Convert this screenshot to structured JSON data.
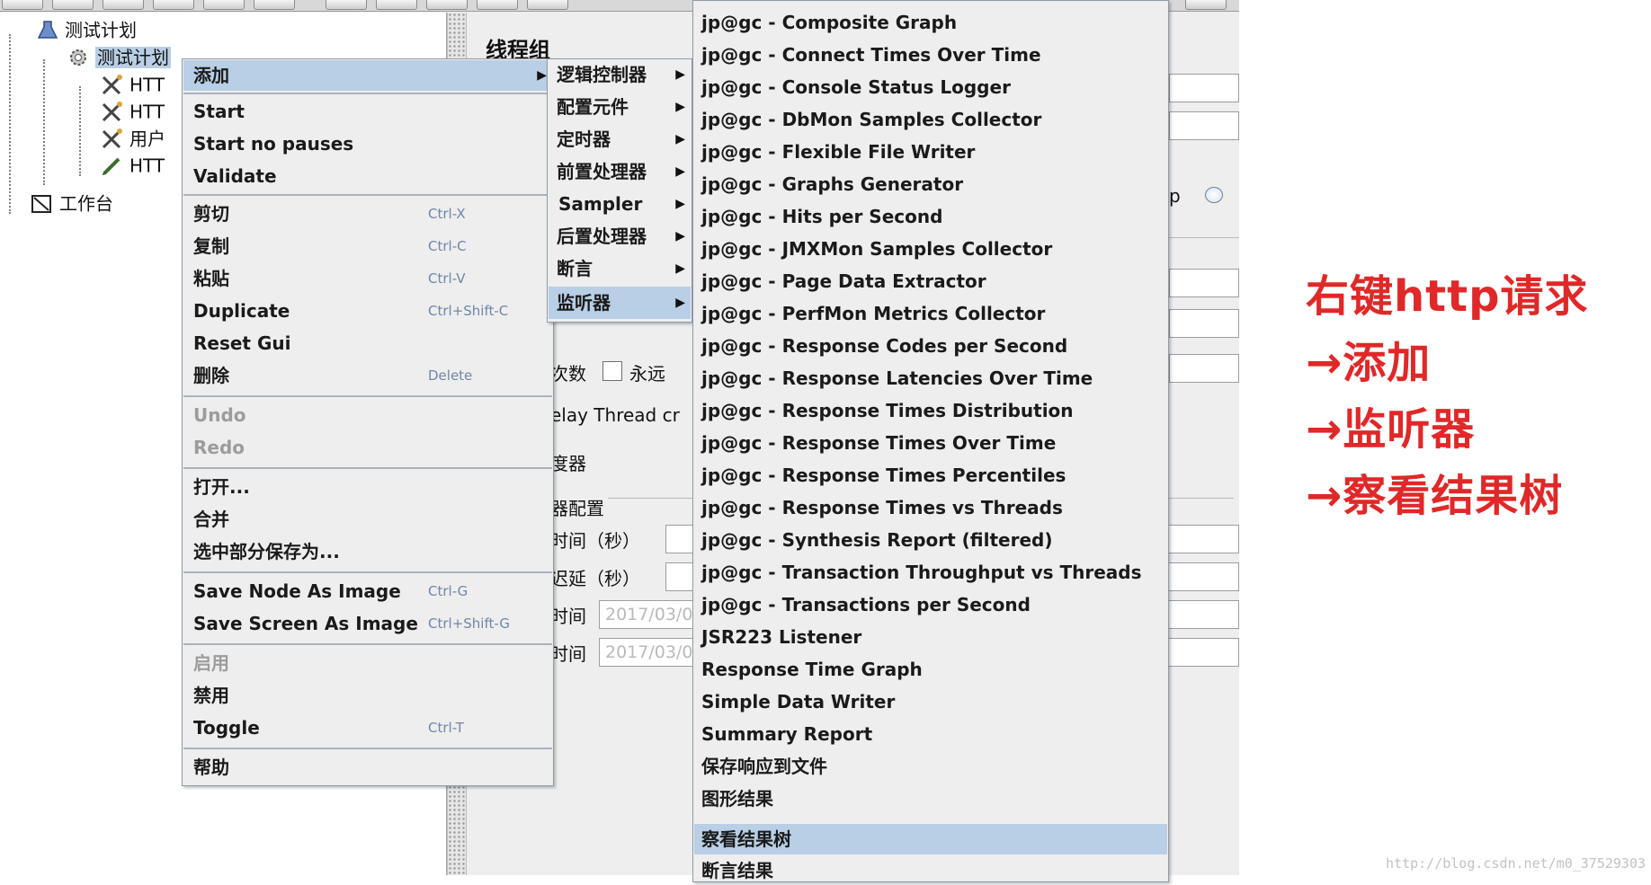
{
  "tree": {
    "items": [
      {
        "label": "测试计划",
        "icon": "test-plan-icon"
      },
      {
        "label": "测试计划",
        "icon": "thread-group-gear-icon"
      },
      {
        "label": "HTT",
        "icon": "http-sampler-icon"
      },
      {
        "label": "HTT",
        "icon": "http-sampler-icon"
      },
      {
        "label": "用户",
        "icon": "user-defined-icon"
      },
      {
        "label": "HTT",
        "icon": "http-sampler-icon"
      },
      {
        "label": "工作台",
        "icon": "workbench-icon"
      }
    ]
  },
  "editor": {
    "title": "线程组",
    "loop_count_label": "次数",
    "forever_label": "永远",
    "delay_label": "elay Thread cr",
    "scheduler_label": "度器",
    "scheduler_config_label": "器配置",
    "duration_label": "时间（秒）",
    "startup_delay_label": "迟延（秒）",
    "start_time_label": "时间",
    "end_time_label": "时间",
    "start_time_value": "2017/03/0",
    "end_time_value": "2017/03/0",
    "radio_label": "p"
  },
  "context_menu": {
    "items": [
      {
        "label": "添加",
        "submenu": true
      },
      {
        "label": "Start"
      },
      {
        "label": "Start no pauses"
      },
      {
        "label": "Validate"
      },
      {
        "label": "剪切",
        "accel": "Ctrl-X"
      },
      {
        "label": "复制",
        "accel": "Ctrl-C"
      },
      {
        "label": "粘贴",
        "accel": "Ctrl-V"
      },
      {
        "label": "Duplicate",
        "accel": "Ctrl+Shift-C"
      },
      {
        "label": "Reset Gui"
      },
      {
        "label": "删除",
        "accel": "Delete"
      },
      {
        "label": "Undo",
        "disabled": true
      },
      {
        "label": "Redo",
        "disabled": true
      },
      {
        "label": "打开..."
      },
      {
        "label": "合并"
      },
      {
        "label": "选中部分保存为..."
      },
      {
        "label": "Save Node As Image",
        "accel": "Ctrl-G"
      },
      {
        "label": "Save Screen As Image",
        "accel": "Ctrl+Shift-G"
      },
      {
        "label": "启用",
        "disabled": true
      },
      {
        "label": "禁用"
      },
      {
        "label": "Toggle",
        "accel": "Ctrl-T"
      },
      {
        "label": "帮助"
      }
    ]
  },
  "add_menu": {
    "items": [
      {
        "label": "逻辑控制器"
      },
      {
        "label": "配置元件"
      },
      {
        "label": "定时器"
      },
      {
        "label": "前置处理器"
      },
      {
        "label": "Sampler"
      },
      {
        "label": "后置处理器"
      },
      {
        "label": "断言"
      },
      {
        "label": "监听器"
      }
    ]
  },
  "listener_menu": {
    "items": [
      {
        "label": "jp@gc - Composite Graph"
      },
      {
        "label": "jp@gc - Connect Times Over Time"
      },
      {
        "label": "jp@gc - Console Status Logger"
      },
      {
        "label": "jp@gc - DbMon Samples Collector"
      },
      {
        "label": "jp@gc - Flexible File Writer"
      },
      {
        "label": "jp@gc - Graphs Generator"
      },
      {
        "label": "jp@gc - Hits per Second"
      },
      {
        "label": "jp@gc - JMXMon Samples Collector"
      },
      {
        "label": "jp@gc - Page Data Extractor"
      },
      {
        "label": "jp@gc - PerfMon Metrics Collector"
      },
      {
        "label": "jp@gc - Response Codes per Second"
      },
      {
        "label": "jp@gc - Response Latencies Over Time"
      },
      {
        "label": "jp@gc - Response Times Distribution"
      },
      {
        "label": "jp@gc - Response Times Over Time"
      },
      {
        "label": "jp@gc - Response Times Percentiles"
      },
      {
        "label": "jp@gc - Response Times vs Threads"
      },
      {
        "label": "jp@gc - Synthesis Report (filtered)"
      },
      {
        "label": "jp@gc - Transaction Throughput vs Threads"
      },
      {
        "label": "jp@gc - Transactions per Second"
      },
      {
        "label": "JSR223 Listener"
      },
      {
        "label": "Response Time Graph"
      },
      {
        "label": "Simple Data Writer"
      },
      {
        "label": "Summary Report"
      },
      {
        "label": "保存响应到文件"
      },
      {
        "label": "图形结果"
      },
      {
        "label": "察看结果树"
      },
      {
        "label": "断言结果"
      }
    ]
  },
  "annotation": {
    "lines": [
      "右键http请求",
      "→添加",
      "→监听器",
      "→察看结果树"
    ],
    "color": "#e02828"
  },
  "watermark": "http://blog.csdn.net/m0_37529303",
  "colors": {
    "menu_bg": "#eeeeee",
    "highlight": "#b8cfe5",
    "accelerator": "#6f86a8",
    "disabled": "#9c9c9c"
  }
}
